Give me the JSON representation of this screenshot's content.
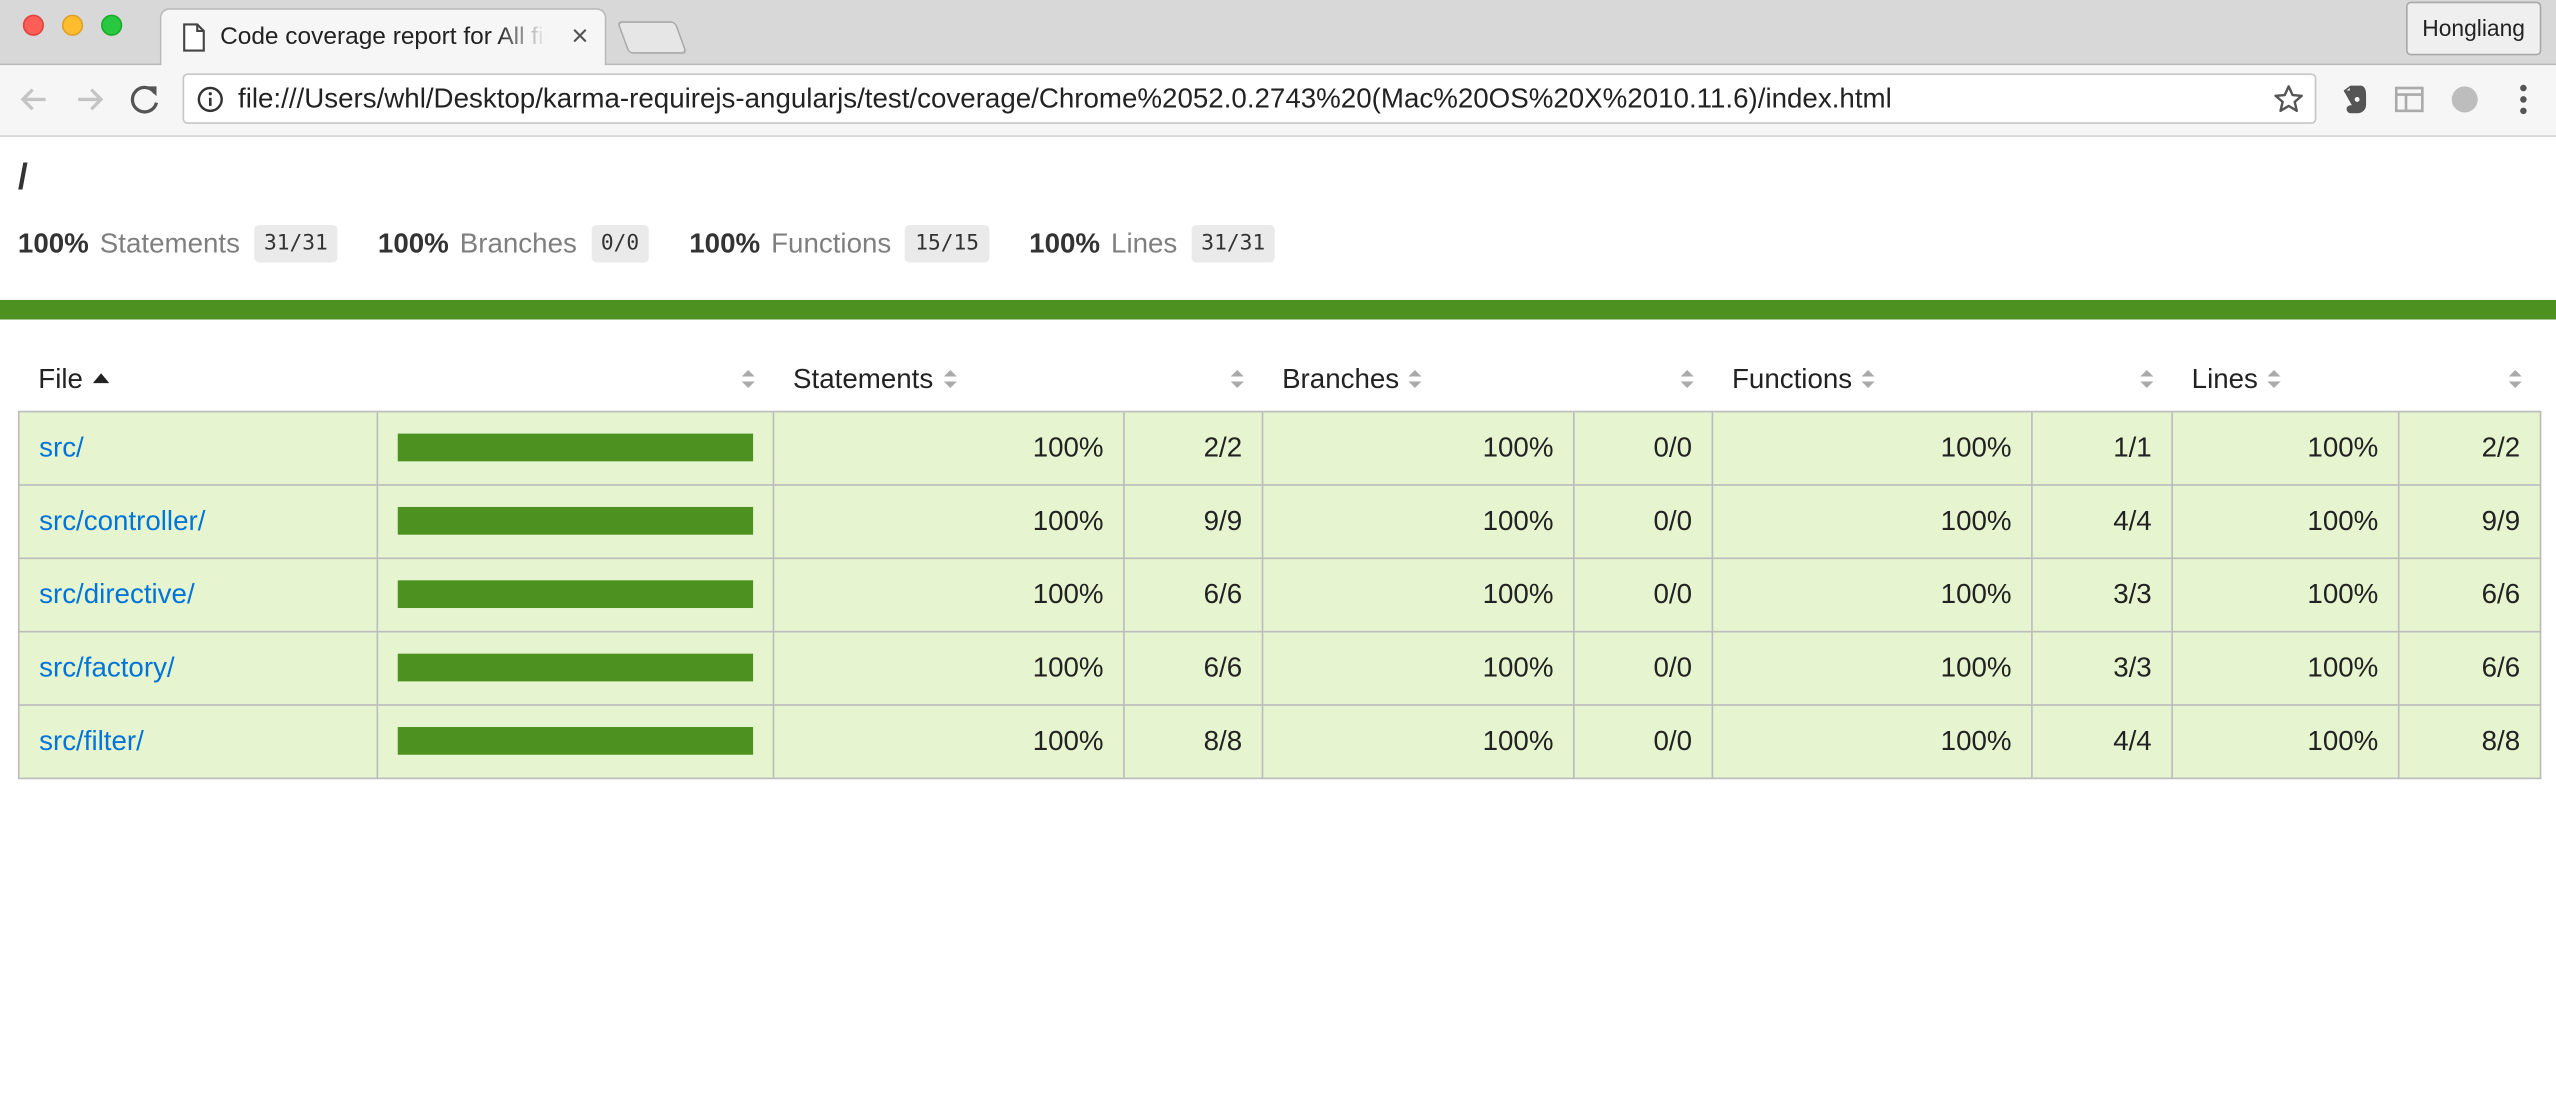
{
  "browser": {
    "tab_title": "Code coverage report for All files",
    "profile_name": "Hongliang",
    "url": "file:///Users/whl/Desktop/karma-requirejs-angularjs/test/coverage/Chrome%2052.0.2743%20(Mac%20OS%20X%2010.11.6)/index.html"
  },
  "report": {
    "breadcrumb": "/",
    "summary": [
      {
        "pct": "100%",
        "label": "Statements",
        "fraction": "31/31"
      },
      {
        "pct": "100%",
        "label": "Branches",
        "fraction": "0/0"
      },
      {
        "pct": "100%",
        "label": "Functions",
        "fraction": "15/15"
      },
      {
        "pct": "100%",
        "label": "Lines",
        "fraction": "31/31"
      }
    ],
    "status_color": "#4d9221",
    "columns": {
      "file": "File",
      "statements": "Statements",
      "branches": "Branches",
      "functions": "Functions",
      "lines": "Lines"
    },
    "rows": [
      {
        "file": "src/",
        "coverage": 1.0,
        "statements_pct": "100%",
        "statements": "2/2",
        "branches_pct": "100%",
        "branches": "0/0",
        "functions_pct": "100%",
        "functions": "1/1",
        "lines_pct": "100%",
        "lines": "2/2"
      },
      {
        "file": "src/controller/",
        "coverage": 1.0,
        "statements_pct": "100%",
        "statements": "9/9",
        "branches_pct": "100%",
        "branches": "0/0",
        "functions_pct": "100%",
        "functions": "4/4",
        "lines_pct": "100%",
        "lines": "9/9"
      },
      {
        "file": "src/directive/",
        "coverage": 1.0,
        "statements_pct": "100%",
        "statements": "6/6",
        "branches_pct": "100%",
        "branches": "0/0",
        "functions_pct": "100%",
        "functions": "3/3",
        "lines_pct": "100%",
        "lines": "6/6"
      },
      {
        "file": "src/factory/",
        "coverage": 1.0,
        "statements_pct": "100%",
        "statements": "6/6",
        "branches_pct": "100%",
        "branches": "0/0",
        "functions_pct": "100%",
        "functions": "3/3",
        "lines_pct": "100%",
        "lines": "6/6"
      },
      {
        "file": "src/filter/",
        "coverage": 1.0,
        "statements_pct": "100%",
        "statements": "8/8",
        "branches_pct": "100%",
        "branches": "0/0",
        "functions_pct": "100%",
        "functions": "4/4",
        "lines_pct": "100%",
        "lines": "8/8"
      }
    ]
  }
}
